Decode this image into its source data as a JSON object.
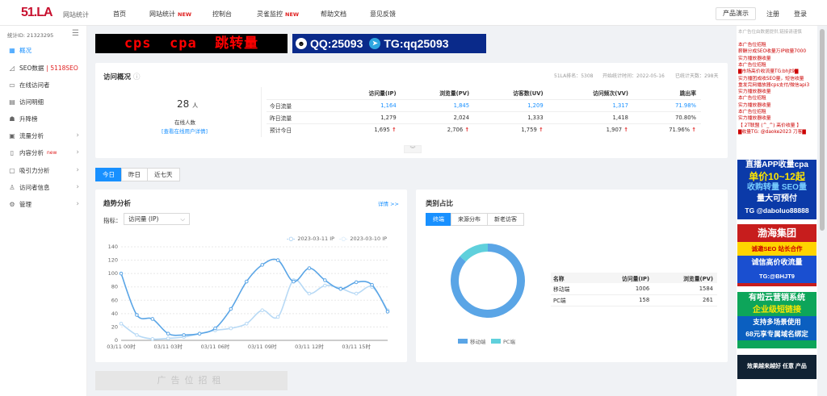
{
  "header": {
    "logo": "51.LA",
    "logo_sub": "网站统计",
    "nav": [
      {
        "label": "首页",
        "new": ""
      },
      {
        "label": "网站统计",
        "new": "NEW"
      },
      {
        "label": "控制台",
        "new": ""
      },
      {
        "label": "灵雀监控",
        "new": "NEW"
      },
      {
        "label": "帮助文档",
        "new": ""
      },
      {
        "label": "意见反馈",
        "new": ""
      }
    ],
    "demo_btn": "产品演示",
    "register": "注册",
    "login": "登录"
  },
  "sidebar": {
    "site_id": "统计ID: 21323295",
    "items": [
      {
        "label": "概况",
        "icon": "grid-icon",
        "active": true
      },
      {
        "label": "SEO数据",
        "extra": "| 5118SEO"
      },
      {
        "label": "在线访问者"
      },
      {
        "label": "访问明细"
      },
      {
        "label": "升降榜"
      },
      {
        "label": "流量分析",
        "arrow": true
      },
      {
        "label": "内容分析",
        "new": "new",
        "arrow": true
      },
      {
        "label": "吸引力分析",
        "arrow": true
      },
      {
        "label": "访问者信息",
        "arrow": true
      },
      {
        "label": "管理",
        "arrow": true
      }
    ]
  },
  "banner1": "cps  cpa  跳转量",
  "banner2": {
    "qq": "QQ:25093",
    "tg": "TG:qq25093"
  },
  "overview": {
    "title": "访问概况",
    "rank": "51LA排名：5308",
    "start": "开始统计时间：2022-05-16",
    "days": "已统计天数：298天",
    "online_count": "28",
    "online_unit": "人",
    "online_label": "在线人数",
    "online_link": "[查看在线用户详情]",
    "columns": [
      "",
      "访问量(IP)",
      "浏览量(PV)",
      "访客数(UV)",
      "访问频次(VV)",
      "跳出率"
    ],
    "rows": [
      {
        "label": "今日流量",
        "values": [
          "1,164",
          "1,845",
          "1,209",
          "1,317",
          "71.98%"
        ]
      },
      {
        "label": "昨日流量",
        "values": [
          "1,279",
          "2,024",
          "1,333",
          "1,418",
          "70.80%"
        ]
      },
      {
        "label": "预计今日",
        "values": [
          "1,695",
          "2,706",
          "1,759",
          "1,907",
          "71.96%"
        ]
      }
    ]
  },
  "tabs": [
    "今日",
    "昨日",
    "近七天"
  ],
  "trend": {
    "title": "趋势分析",
    "detail_link": "详情 >>",
    "metric_label": "指标：",
    "metric_value": "访问量 (IP)"
  },
  "chart_data": {
    "type": "line",
    "x": [
      "03/11 00时",
      "03/11 01时",
      "03/11 02时",
      "03/11 03时",
      "03/11 04时",
      "03/11 05时",
      "03/11 06时",
      "03/11 07时",
      "03/11 08时",
      "03/11 09时",
      "03/11 10时",
      "03/11 11时",
      "03/11 12时",
      "03/11 13时",
      "03/11 14时",
      "03/11 15时",
      "03/11 16时",
      "03/11 17时"
    ],
    "xticks": [
      "03/11 00时",
      "03/11 03时",
      "03/11 06时",
      "03/11 09时",
      "03/11 12时",
      "03/11 15时"
    ],
    "yticks": [
      0,
      20,
      40,
      60,
      80,
      100,
      120,
      140
    ],
    "ylim": [
      0,
      140
    ],
    "series": [
      {
        "name": "2023-03-11 IP",
        "color": "#5aa5e6",
        "values": [
          100,
          38,
          32,
          10,
          8,
          10,
          18,
          47,
          88,
          113,
          120,
          88,
          108,
          90,
          77,
          87,
          83,
          43
        ]
      },
      {
        "name": "2023-03-10 IP",
        "color": "#b7d9f5",
        "values": [
          25,
          8,
          2,
          3,
          5,
          10,
          15,
          18,
          25,
          45,
          35,
          90,
          70,
          82,
          78,
          70,
          80,
          45
        ]
      }
    ]
  },
  "category": {
    "title": "类别占比",
    "tabs": [
      "终端",
      "来源分布",
      "新老访客"
    ],
    "legend": [
      "移动端",
      "PC端"
    ],
    "pie_colors": [
      "#5aa5e6",
      "#5fd0dc"
    ],
    "pie_values": [
      1006,
      158
    ],
    "columns": [
      "名称",
      "访问量(IP)",
      "浏览量(PV)"
    ],
    "rows": [
      [
        "移动端",
        "1006",
        "1584"
      ],
      [
        "PC端",
        "158",
        "261"
      ]
    ]
  },
  "ad_placeholder": "广告位招租",
  "right": {
    "top_note": "本广告位由数据提供,链接请谨慎",
    "lines": [
      "本广告位招租",
      "薪酬分成SEO收量万IP收量7000",
      "实力播放器收量",
      "本广告位招租",
      "▇市场高价收流量TG:bhjt9▇",
      "实力播团成收SEO量，短信收量",
      "重发完网播放器cps支付/微信api3",
      "实力播放器收量",
      "本广告位招租",
      "实力播放器收量",
      "本广告位招租",
      "实力播放器收量",
      "【 2T联盟 (^_^) 高价收量 】",
      "▇收量TG: @daoke2023 刀客▇"
    ],
    "ad1": [
      "直播APP收量cpa",
      "单价10~12起",
      "收购转量 SEO量",
      "量大可预付",
      "TG @daboluo88888"
    ],
    "ad2": [
      "渤海集团",
      "诚邀SEO 站长合作",
      "诚信高价收流量",
      "TG:@BHJT9"
    ],
    "ad3": [
      "有啦云营销系统",
      "企业级短链接",
      "支持多场景使用",
      "68元享专属域名绑定"
    ],
    "ad4": "效果越来越好 任意 产品"
  }
}
